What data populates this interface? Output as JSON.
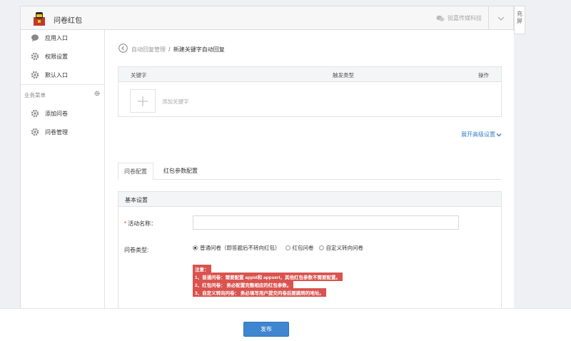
{
  "header": {
    "app_title": "问卷红包",
    "brand": "锐嘉传媒科技"
  },
  "fullscreen": {
    "line1": "充",
    "line2": "屏"
  },
  "sidebar": {
    "items": [
      {
        "label": "应用入口",
        "icon": "chat-bubble-icon"
      },
      {
        "label": "权限设置",
        "icon": "gear-icon"
      },
      {
        "label": "默认入口",
        "icon": "gear-icon"
      }
    ],
    "section_label": "业务菜单",
    "section_items": [
      {
        "label": "添加问卷",
        "icon": "gear-icon"
      },
      {
        "label": "问卷管理",
        "icon": "gear-icon"
      }
    ]
  },
  "breadcrumb": {
    "parent": "自动回复管理",
    "separator": "/",
    "current": "新建关键字自动回复"
  },
  "keyword_table": {
    "columns": [
      "关键字",
      "触发类型",
      "操作"
    ],
    "add_label": "添加关键字"
  },
  "advanced_link": "展开高级设置",
  "tabs": [
    {
      "label": "问卷配置",
      "active": true
    },
    {
      "label": "红包参数配置",
      "active": false
    }
  ],
  "panel": {
    "title": "基本设置",
    "name_label": "活动名称：",
    "name_required": "*",
    "name_value": "",
    "type_label": "问卷类型:",
    "type_options": [
      {
        "label": "普通问卷（即答题后不转向红包）",
        "selected": true
      },
      {
        "label": "红包问卷",
        "selected": false
      },
      {
        "label": "自定义转向问卷",
        "selected": false
      }
    ],
    "notice": [
      "注意：",
      "1、普通问卷：需要配置 appid和 appsert，其他红包参数不需要配置。",
      "2、红包问卷： 务必配置完整相应的红包参数。",
      "3、自定义转向问卷： 务必填写用户提交问卷后要跳转的地址。"
    ]
  },
  "footer": {
    "publish_label": "发布"
  },
  "colors": {
    "accent": "#3e86cf",
    "notice_bg": "#d9534f",
    "link": "#3a80c8"
  }
}
